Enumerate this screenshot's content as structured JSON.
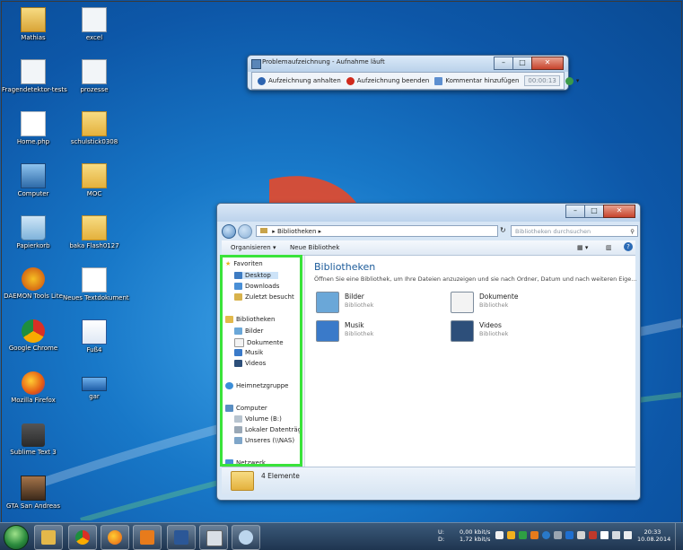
{
  "desktop_icons": [
    {
      "label": "Mathias",
      "icon": "user-folder-icon",
      "col": 0,
      "row": 0
    },
    {
      "label": "excel",
      "icon": "document-icon",
      "col": 1,
      "row": 0
    },
    {
      "label": "Fragendetektor-tests",
      "icon": "document-icon",
      "col": 0,
      "row": 1
    },
    {
      "label": "prozesse",
      "icon": "document-icon",
      "col": 1,
      "row": 1
    },
    {
      "label": "Home.php",
      "icon": "file-icon",
      "col": 0,
      "row": 2
    },
    {
      "label": "schulstick0308",
      "icon": "folder-icon",
      "col": 1,
      "row": 2
    },
    {
      "label": "Computer",
      "icon": "computer-icon",
      "col": 0,
      "row": 3
    },
    {
      "label": "MOC",
      "icon": "folder-icon",
      "col": 1,
      "row": 3
    },
    {
      "label": "Papierkorb",
      "icon": "recycle-bin-icon",
      "col": 0,
      "row": 4
    },
    {
      "label": "baka Flash0127",
      "icon": "folder-icon",
      "col": 1,
      "row": 4
    },
    {
      "label": "DAEMON Tools Lite",
      "icon": "daemon-tools-icon",
      "col": 0,
      "row": 5
    },
    {
      "label": "Neues Textdokument",
      "icon": "text-document-icon",
      "col": 1,
      "row": 5
    },
    {
      "label": "Google Chrome",
      "icon": "chrome-icon",
      "col": 0,
      "row": 6
    },
    {
      "label": "Fuß4",
      "icon": "word-document-icon",
      "col": 1,
      "row": 6
    },
    {
      "label": "Mozilla Firefox",
      "icon": "firefox-icon",
      "col": 0,
      "row": 7
    },
    {
      "label": "gar",
      "icon": "window-icon",
      "col": 1,
      "row": 7
    },
    {
      "label": "Sublime Text 3",
      "icon": "sublime-icon",
      "col": 0,
      "row": 8
    },
    {
      "label": "GTA San Andreas",
      "icon": "gta-icon",
      "col": 0,
      "row": 9
    }
  ],
  "psr": {
    "title": "Problemaufzeichnung - Aufnahme läuft",
    "pause": "Aufzeichnung anhalten",
    "stop": "Aufzeichnung beenden",
    "comment": "Kommentar hinzufügen",
    "timer": "00:00:13"
  },
  "explorer": {
    "address": "Bibliotheken",
    "search_placeholder": "Bibliotheken durchsuchen",
    "organize": "Organisieren ▾",
    "new_library": "Neue Bibliothek",
    "nav": {
      "favorites": "Favoriten",
      "desktop": "Desktop",
      "downloads": "Downloads",
      "recent": "Zuletzt besucht",
      "libraries": "Bibliotheken",
      "pictures": "Bilder",
      "documents": "Dokumente",
      "music": "Musik",
      "videos": "Videos",
      "homegroup": "Heimnetzgruppe",
      "computer": "Computer",
      "volume_b": "Volume (B:)",
      "local_disk": "Lokaler Datenträg",
      "unseres": "Unseres (\\\\NAS)",
      "network": "Netzwerk"
    },
    "content_title": "Bibliotheken",
    "content_sub": "Öffnen Sie eine Bibliothek, um Ihre Dateien anzuzeigen und sie nach Ordner, Datum und nach weiteren Eige...",
    "libraries": [
      {
        "name": "Bilder",
        "type": "Bibliothek",
        "icon": "pictures-library-icon"
      },
      {
        "name": "Dokumente",
        "type": "Bibliothek",
        "icon": "documents-library-icon"
      },
      {
        "name": "Musik",
        "type": "Bibliothek",
        "icon": "music-library-icon"
      },
      {
        "name": "Videos",
        "type": "Bibliothek",
        "icon": "videos-library-icon"
      }
    ],
    "status": "4 Elemente"
  },
  "taskbar": {
    "net_up_label": "U:",
    "net_down_label": "D:",
    "net_up": "0,00 kbit/s",
    "net_down": "1,72 kbit/s",
    "time": "20:33",
    "date": "10.08.2014"
  },
  "colors": {
    "highlight": "#3ae33a",
    "accent": "#1c5b9a"
  }
}
